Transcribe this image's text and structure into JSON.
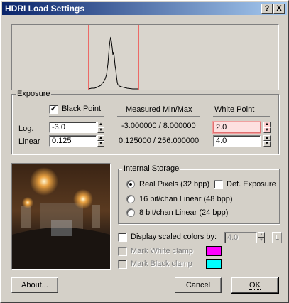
{
  "window": {
    "title": "HDRI Load Settings",
    "help_button": "?",
    "close_button": "X"
  },
  "exposure": {
    "group_label": "Exposure",
    "black_point": {
      "label": "Black Point",
      "checked": true
    },
    "measured_header": "Measured Min/Max",
    "white_point_header": "White Point",
    "log_label": "Log.",
    "linear_label": "Linear",
    "black_log_value": "-3.0",
    "black_linear_value": "0.125",
    "measured_log": "-3.000000 / 8.000000",
    "measured_linear": "0.125000 / 256.000000",
    "white_log_value": "2.0",
    "white_linear_value": "4.0"
  },
  "internal_storage": {
    "group_label": "Internal Storage",
    "options": [
      {
        "label": "Real Pixels (32 bpp)",
        "selected": true
      },
      {
        "label": "16 bit/chan Linear (48 bpp)",
        "selected": false
      },
      {
        "label": "8 bit/chan Linear (24 bpp)",
        "selected": false
      }
    ],
    "def_exposure": {
      "label": "Def. Exposure",
      "checked": false
    }
  },
  "display_scaled": {
    "label": "Display scaled colors by:",
    "checked": false,
    "value": "4.0",
    "lock_label": "L"
  },
  "mark_white_clamp": {
    "label": "Mark White clamp",
    "color": "#ff00ff"
  },
  "mark_black_clamp": {
    "label": "Mark Black clamp",
    "color": "#00ffff"
  },
  "buttons": {
    "about": "About...",
    "cancel": "Cancel",
    "ok": "OK"
  },
  "colors": {
    "title_bar_start": "#0a246a",
    "title_bar_end": "#a6caf0",
    "dialog_bg": "#d4d0c8",
    "histogram_bg": "#d9d5cd",
    "clip_line": "#ff0000"
  }
}
